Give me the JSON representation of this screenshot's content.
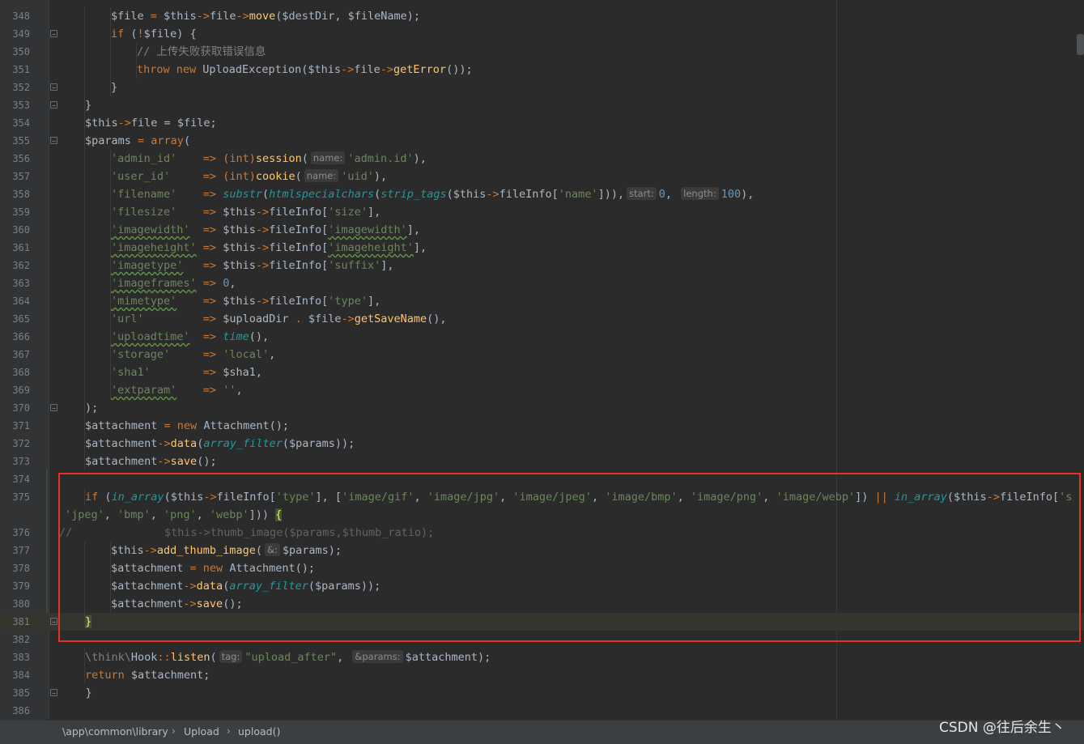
{
  "lines": [
    {
      "n": "348",
      "f": "",
      "hl": false,
      "indent": 2,
      "t": [
        [
          "$file",
          "v"
        ],
        [
          " = ",
          "o"
        ],
        [
          "$this",
          "v"
        ],
        [
          "->",
          "o"
        ],
        [
          "file",
          "v"
        ],
        [
          "->",
          "o"
        ],
        [
          "move",
          "f"
        ],
        [
          "($destDir, $fileName);",
          "v"
        ]
      ]
    },
    {
      "n": "349",
      "f": "−",
      "hl": false,
      "indent": 2,
      "t": [
        [
          "if",
          "k"
        ],
        [
          " (",
          "v"
        ],
        [
          "!",
          "o"
        ],
        [
          "$file) {",
          "v"
        ]
      ]
    },
    {
      "n": "350",
      "f": "",
      "hl": false,
      "indent": 3,
      "t": [
        [
          "// 上传失败获取错误信息",
          "c"
        ]
      ]
    },
    {
      "n": "351",
      "f": "",
      "hl": false,
      "indent": 3,
      "t": [
        [
          "throw new ",
          "k"
        ],
        [
          "UploadException",
          "v"
        ],
        [
          "(",
          "v"
        ],
        [
          "$this",
          "v"
        ],
        [
          "->",
          "o"
        ],
        [
          "file",
          "v"
        ],
        [
          "->",
          "o"
        ],
        [
          "getError",
          "f"
        ],
        [
          "());",
          "v"
        ]
      ]
    },
    {
      "n": "352",
      "f": "−",
      "hl": false,
      "indent": 2,
      "t": [
        [
          "}",
          "v"
        ]
      ]
    },
    {
      "n": "353",
      "f": "−",
      "hl": false,
      "indent": 1,
      "t": [
        [
          "}",
          "v"
        ]
      ]
    },
    {
      "n": "354",
      "f": "",
      "hl": false,
      "indent": 1,
      "t": [
        [
          "$this",
          "v"
        ],
        [
          "->",
          "o"
        ],
        [
          "file",
          "v"
        ],
        [
          " = ",
          "v"
        ],
        [
          "$file;",
          "v"
        ]
      ]
    },
    {
      "n": "355",
      "f": "−",
      "hl": false,
      "indent": 1,
      "t": [
        [
          "$params",
          "v"
        ],
        [
          " = ",
          "o"
        ],
        [
          "array",
          "k"
        ],
        [
          "(",
          "v"
        ]
      ]
    },
    {
      "n": "356",
      "f": "",
      "hl": false,
      "indent": 2,
      "t": [
        [
          "'admin_id'",
          "s"
        ],
        [
          "    => ",
          "o"
        ],
        [
          "(int)",
          "k"
        ],
        [
          "session",
          "f"
        ],
        [
          "(",
          "v"
        ],
        [
          "name:",
          "h"
        ],
        [
          "'admin.id'",
          "s"
        ],
        [
          "),",
          "v"
        ]
      ]
    },
    {
      "n": "357",
      "f": "",
      "hl": false,
      "indent": 2,
      "t": [
        [
          "'user_id'",
          "s"
        ],
        [
          "     => ",
          "o"
        ],
        [
          "(int)",
          "k"
        ],
        [
          "cookie",
          "f"
        ],
        [
          "(",
          "v"
        ],
        [
          "name:",
          "h"
        ],
        [
          "'uid'",
          "s"
        ],
        [
          "),",
          "v"
        ]
      ]
    },
    {
      "n": "358",
      "f": "",
      "hl": false,
      "indent": 2,
      "t": [
        [
          "'filename'",
          "s"
        ],
        [
          "    => ",
          "o"
        ],
        [
          "substr",
          "i"
        ],
        [
          "(",
          "v"
        ],
        [
          "htmlspecialchars",
          "i"
        ],
        [
          "(",
          "v"
        ],
        [
          "strip_tags",
          "i"
        ],
        [
          "($this",
          "v"
        ],
        [
          "->",
          "o"
        ],
        [
          "fileInfo[",
          "v"
        ],
        [
          "'name'",
          "s"
        ],
        [
          "])),",
          "v"
        ],
        [
          "start:",
          "h"
        ],
        [
          "0",
          "n"
        ],
        [
          ", ",
          "v"
        ],
        [
          "length:",
          "h"
        ],
        [
          "100",
          "n"
        ],
        [
          "),",
          "v"
        ]
      ]
    },
    {
      "n": "359",
      "f": "",
      "hl": false,
      "indent": 2,
      "t": [
        [
          "'filesize'",
          "s"
        ],
        [
          "    => ",
          "o"
        ],
        [
          "$this",
          "v"
        ],
        [
          "->",
          "o"
        ],
        [
          "fileInfo[",
          "v"
        ],
        [
          "'size'",
          "s"
        ],
        [
          "],",
          "v"
        ]
      ]
    },
    {
      "n": "360",
      "f": "",
      "hl": false,
      "indent": 2,
      "t": [
        [
          "'imagewidth'",
          "su"
        ],
        [
          "  => ",
          "o"
        ],
        [
          "$this",
          "v"
        ],
        [
          "->",
          "o"
        ],
        [
          "fileInfo[",
          "v"
        ],
        [
          "'imagewidth'",
          "su"
        ],
        [
          "],",
          "v"
        ]
      ]
    },
    {
      "n": "361",
      "f": "",
      "hl": false,
      "indent": 2,
      "t": [
        [
          "'imageheight'",
          "su"
        ],
        [
          " => ",
          "o"
        ],
        [
          "$this",
          "v"
        ],
        [
          "->",
          "o"
        ],
        [
          "fileInfo[",
          "v"
        ],
        [
          "'imageheight'",
          "su"
        ],
        [
          "],",
          "v"
        ]
      ]
    },
    {
      "n": "362",
      "f": "",
      "hl": false,
      "indent": 2,
      "t": [
        [
          "'imagetype'",
          "su"
        ],
        [
          "   => ",
          "o"
        ],
        [
          "$this",
          "v"
        ],
        [
          "->",
          "o"
        ],
        [
          "fileInfo[",
          "v"
        ],
        [
          "'suffix'",
          "s"
        ],
        [
          "],",
          "v"
        ]
      ]
    },
    {
      "n": "363",
      "f": "",
      "hl": false,
      "indent": 2,
      "t": [
        [
          "'imageframes'",
          "su"
        ],
        [
          " => ",
          "o"
        ],
        [
          "0",
          "n"
        ],
        [
          ",",
          "v"
        ]
      ]
    },
    {
      "n": "364",
      "f": "",
      "hl": false,
      "indent": 2,
      "t": [
        [
          "'mimetype'",
          "su"
        ],
        [
          "    => ",
          "o"
        ],
        [
          "$this",
          "v"
        ],
        [
          "->",
          "o"
        ],
        [
          "fileInfo[",
          "v"
        ],
        [
          "'type'",
          "s"
        ],
        [
          "],",
          "v"
        ]
      ]
    },
    {
      "n": "365",
      "f": "",
      "hl": false,
      "indent": 2,
      "t": [
        [
          "'url'",
          "s"
        ],
        [
          "         => ",
          "o"
        ],
        [
          "$uploadDir ",
          "v"
        ],
        [
          ". ",
          "o"
        ],
        [
          "$file",
          "v"
        ],
        [
          "->",
          "o"
        ],
        [
          "getSaveName",
          "f"
        ],
        [
          "(),",
          "v"
        ]
      ]
    },
    {
      "n": "366",
      "f": "",
      "hl": false,
      "indent": 2,
      "t": [
        [
          "'uploadtime'",
          "su"
        ],
        [
          "  => ",
          "o"
        ],
        [
          "time",
          "i"
        ],
        [
          "(),",
          "v"
        ]
      ]
    },
    {
      "n": "367",
      "f": "",
      "hl": false,
      "indent": 2,
      "t": [
        [
          "'storage'",
          "s"
        ],
        [
          "     => ",
          "o"
        ],
        [
          "'local'",
          "s"
        ],
        [
          ",",
          "v"
        ]
      ]
    },
    {
      "n": "368",
      "f": "",
      "hl": false,
      "indent": 2,
      "t": [
        [
          "'sha1'",
          "s"
        ],
        [
          "        => ",
          "o"
        ],
        [
          "$sha1,",
          "v"
        ]
      ]
    },
    {
      "n": "369",
      "f": "",
      "hl": false,
      "indent": 2,
      "t": [
        [
          "'extparam'",
          "su"
        ],
        [
          "    => ",
          "o"
        ],
        [
          "''",
          "s"
        ],
        [
          ",",
          "v"
        ]
      ]
    },
    {
      "n": "370",
      "f": "−",
      "hl": false,
      "indent": 1,
      "t": [
        [
          ");",
          "v"
        ]
      ]
    },
    {
      "n": "371",
      "f": "",
      "hl": false,
      "indent": 1,
      "t": [
        [
          "$attachment",
          "v"
        ],
        [
          " = ",
          "o"
        ],
        [
          "new ",
          "k"
        ],
        [
          "Attachment",
          "v"
        ],
        [
          "();",
          "v"
        ]
      ]
    },
    {
      "n": "372",
      "f": "",
      "hl": false,
      "indent": 1,
      "t": [
        [
          "$attachment",
          "v"
        ],
        [
          "->",
          "o"
        ],
        [
          "data",
          "f"
        ],
        [
          "(",
          "v"
        ],
        [
          "array_filter",
          "i"
        ],
        [
          "($params));",
          "v"
        ]
      ]
    },
    {
      "n": "373",
      "f": "",
      "hl": false,
      "indent": 1,
      "t": [
        [
          "$attachment",
          "v"
        ],
        [
          "->",
          "o"
        ],
        [
          "save",
          "f"
        ],
        [
          "();",
          "v"
        ]
      ]
    },
    {
      "n": "374",
      "f": "",
      "hl": false,
      "indent": 0,
      "t": []
    },
    {
      "n": "375",
      "f": "",
      "hl": false,
      "indent": 1,
      "t": [
        [
          "if",
          "k"
        ],
        [
          " (",
          "v"
        ],
        [
          "in_array",
          "i"
        ],
        [
          "($this",
          "v"
        ],
        [
          "->",
          "o"
        ],
        [
          "fileInfo[",
          "v"
        ],
        [
          "'type'",
          "s"
        ],
        [
          "], [",
          "v"
        ],
        [
          "'image/gif'",
          "s"
        ],
        [
          ", ",
          "v"
        ],
        [
          "'image/jpg'",
          "s"
        ],
        [
          ", ",
          "v"
        ],
        [
          "'image/jpeg'",
          "s"
        ],
        [
          ", ",
          "v"
        ],
        [
          "'image/bmp'",
          "s"
        ],
        [
          ", ",
          "v"
        ],
        [
          "'image/png'",
          "s"
        ],
        [
          ", ",
          "v"
        ],
        [
          "'image/webp'",
          "s"
        ],
        [
          "]) ",
          "v"
        ],
        [
          "|| ",
          "o"
        ],
        [
          "in_array",
          "i"
        ],
        [
          "($this",
          "v"
        ],
        [
          "->",
          "o"
        ],
        [
          "fileInfo[",
          "v"
        ],
        [
          "'s",
          "s"
        ]
      ]
    },
    {
      "n": "",
      "f": "",
      "hl": false,
      "indent": 0,
      "t": [
        [
          "'jpeg'",
          "s"
        ],
        [
          ", ",
          "v"
        ],
        [
          "'bmp'",
          "s"
        ],
        [
          ", ",
          "v"
        ],
        [
          "'png'",
          "s"
        ],
        [
          ", ",
          "v"
        ],
        [
          "'webp'",
          "s"
        ],
        [
          "])) ",
          "v"
        ],
        [
          "{",
          "b"
        ]
      ]
    },
    {
      "n": "376",
      "f": "",
      "hl": false,
      "indent": 0,
      "t": [
        [
          "//              $this->thumb_image($params,$thumb_ratio);",
          "cd"
        ]
      ]
    },
    {
      "n": "377",
      "f": "",
      "hl": false,
      "indent": 2,
      "t": [
        [
          "$this",
          "v"
        ],
        [
          "->",
          "o"
        ],
        [
          "add_thumb_image",
          "f"
        ],
        [
          "(",
          "v"
        ],
        [
          "&:",
          "h"
        ],
        [
          "$params);",
          "v"
        ]
      ]
    },
    {
      "n": "378",
      "f": "",
      "hl": false,
      "indent": 2,
      "t": [
        [
          "$attachment",
          "v"
        ],
        [
          " = ",
          "o"
        ],
        [
          "new ",
          "k"
        ],
        [
          "Attachment",
          "v"
        ],
        [
          "();",
          "v"
        ]
      ]
    },
    {
      "n": "379",
      "f": "",
      "hl": false,
      "indent": 2,
      "t": [
        [
          "$attachment",
          "v"
        ],
        [
          "->",
          "o"
        ],
        [
          "data",
          "f"
        ],
        [
          "(",
          "v"
        ],
        [
          "array_filter",
          "i"
        ],
        [
          "($params));",
          "v"
        ]
      ]
    },
    {
      "n": "380",
      "f": "",
      "hl": false,
      "indent": 2,
      "t": [
        [
          "$attachment",
          "v"
        ],
        [
          "->",
          "o"
        ],
        [
          "save",
          "f"
        ],
        [
          "();",
          "v"
        ]
      ]
    },
    {
      "n": "381",
      "f": "−",
      "hl": true,
      "indent": 1,
      "t": [
        [
          "}",
          "b"
        ]
      ]
    },
    {
      "n": "382",
      "f": "",
      "hl": false,
      "indent": 0,
      "t": []
    },
    {
      "n": "383",
      "f": "",
      "hl": false,
      "indent": 1,
      "t": [
        [
          "\\think\\",
          "c"
        ],
        [
          "Hook",
          "v"
        ],
        [
          "::",
          "o"
        ],
        [
          "listen",
          "f"
        ],
        [
          "(",
          "v"
        ],
        [
          "tag:",
          "h"
        ],
        [
          "\"upload_after\"",
          "s"
        ],
        [
          ", ",
          "v"
        ],
        [
          "&params:",
          "h"
        ],
        [
          "$attachment);",
          "v"
        ]
      ]
    },
    {
      "n": "384",
      "f": "",
      "hl": false,
      "indent": 1,
      "t": [
        [
          "return ",
          "k"
        ],
        [
          "$attachment;",
          "v"
        ]
      ]
    },
    {
      "n": "385",
      "f": "−",
      "hl": false,
      "indent": 0,
      "t": [
        [
          "    }",
          "v"
        ]
      ]
    },
    {
      "n": "386",
      "f": "",
      "hl": false,
      "indent": 0,
      "t": []
    }
  ],
  "breadcrumb": {
    "path": "\\app\\common\\library",
    "class_name": "Upload",
    "method": "upload()"
  },
  "watermark": "CSDN @往后余生丶",
  "colors": {
    "background": "#2b2b2b",
    "gutter": "#313335",
    "highlight_box": "#e8302a",
    "keyword": "#cc7832",
    "string": "#6a8759",
    "number": "#6897bb",
    "function": "#ffc66d",
    "builtin_function": "#20999d"
  }
}
